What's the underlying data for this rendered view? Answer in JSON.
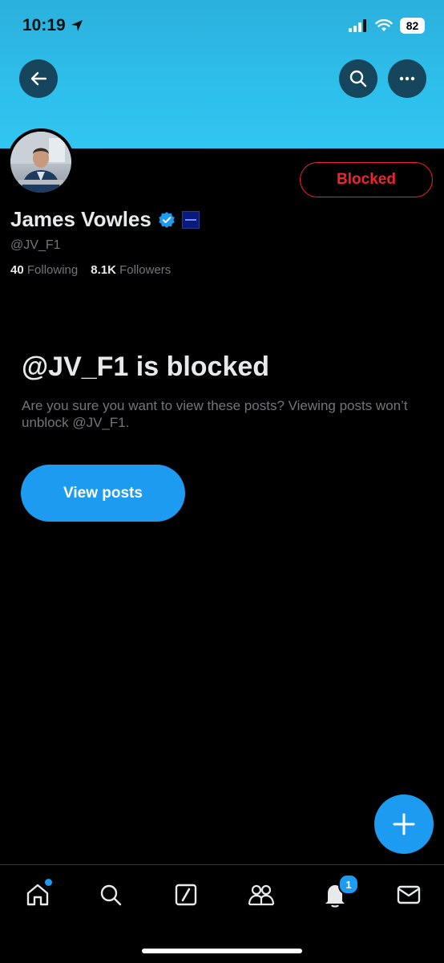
{
  "status_bar": {
    "time": "10:19",
    "battery": "82",
    "icons": [
      "location-arrow-icon",
      "cellular-signal-icon",
      "wifi-icon",
      "battery-icon"
    ]
  },
  "header": {
    "back_icon": "arrow-left-icon",
    "search_icon": "search-icon",
    "more_icon": "more-horizontal-icon"
  },
  "profile": {
    "display_name": "James Vowles",
    "handle": "@JV_F1",
    "following_count": "40",
    "following_label": "Following",
    "followers_count": "8.1K",
    "followers_label": "Followers",
    "blocked_button_label": "Blocked",
    "badges": [
      "verified-badge-icon",
      "affiliation-badge"
    ]
  },
  "blocked_notice": {
    "title": "@JV_F1 is blocked",
    "description": "Are you sure you want to view these posts? Viewing posts won’t unblock @JV_F1.",
    "view_posts_label": "View posts"
  },
  "tab_bar": {
    "items": [
      {
        "name": "home",
        "icon": "home-icon"
      },
      {
        "name": "search",
        "icon": "search-icon"
      },
      {
        "name": "grok",
        "icon": "slash-square-icon"
      },
      {
        "name": "communities",
        "icon": "people-icon"
      },
      {
        "name": "notifications",
        "icon": "bell-icon",
        "badge": "1"
      },
      {
        "name": "messages",
        "icon": "mail-icon"
      }
    ]
  },
  "colors": {
    "accent": "#1d9bf0",
    "danger": "#f4212e",
    "banner": "#2ebfeb",
    "background": "#000000",
    "secondary_text": "#71767b"
  }
}
